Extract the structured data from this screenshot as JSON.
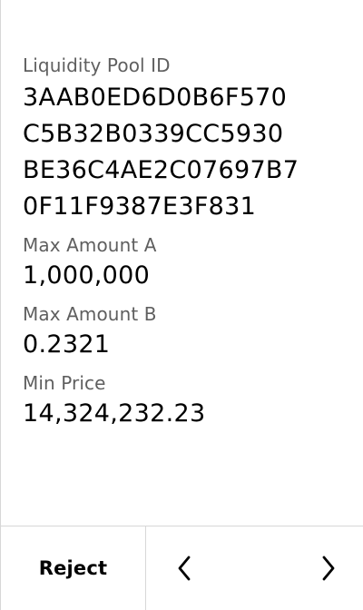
{
  "fields": {
    "pool_id": {
      "label": "Liquidity Pool ID",
      "lines": [
        "3AAB0ED6D0B6F570",
        "C5B32B0339CC5930",
        "BE36C4AE2C07697B7",
        "0F11F9387E3F831"
      ]
    },
    "max_amount_a": {
      "label": "Max Amount A",
      "value": "1,000,000"
    },
    "max_amount_b": {
      "label": "Max Amount B",
      "value": "0.2321"
    },
    "min_price": {
      "label": "Min Price",
      "value": "14,324,232.23"
    }
  },
  "footer": {
    "reject_label": "Reject",
    "previous_icon": "chevron-left-icon",
    "next_icon": "chevron-right-icon"
  }
}
